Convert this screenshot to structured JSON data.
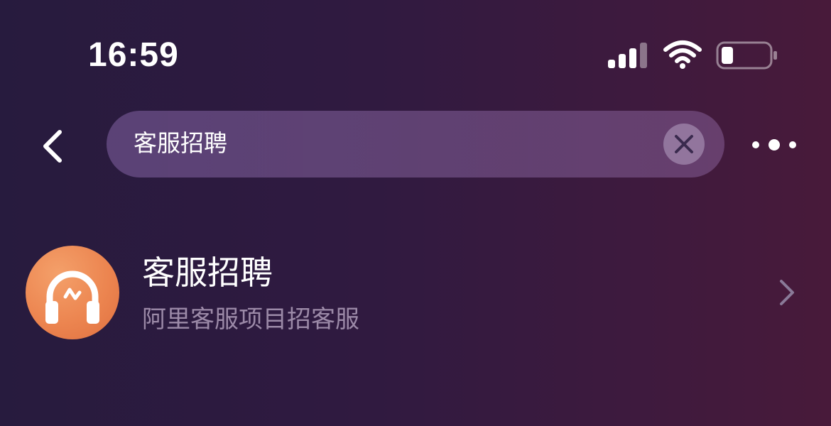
{
  "status_bar": {
    "time": "16:59",
    "signal_icon": "cellular-signal-icon",
    "wifi_icon": "wifi-icon",
    "battery_icon": "battery-icon",
    "battery_level": 0.25
  },
  "nav": {
    "back_icon": "chevron-left-icon",
    "search": {
      "value": "客服招聘",
      "clear_icon": "clear-icon"
    },
    "more_icon": "more-dots-icon"
  },
  "results": [
    {
      "icon": "headset-icon",
      "title": "客服招聘",
      "subtitle": "阿里客服项目招客服",
      "chevron_icon": "chevron-right-icon"
    }
  ],
  "colors": {
    "icon_orange": "#ec8550",
    "subtitle_gray": "#9c8aa8"
  }
}
